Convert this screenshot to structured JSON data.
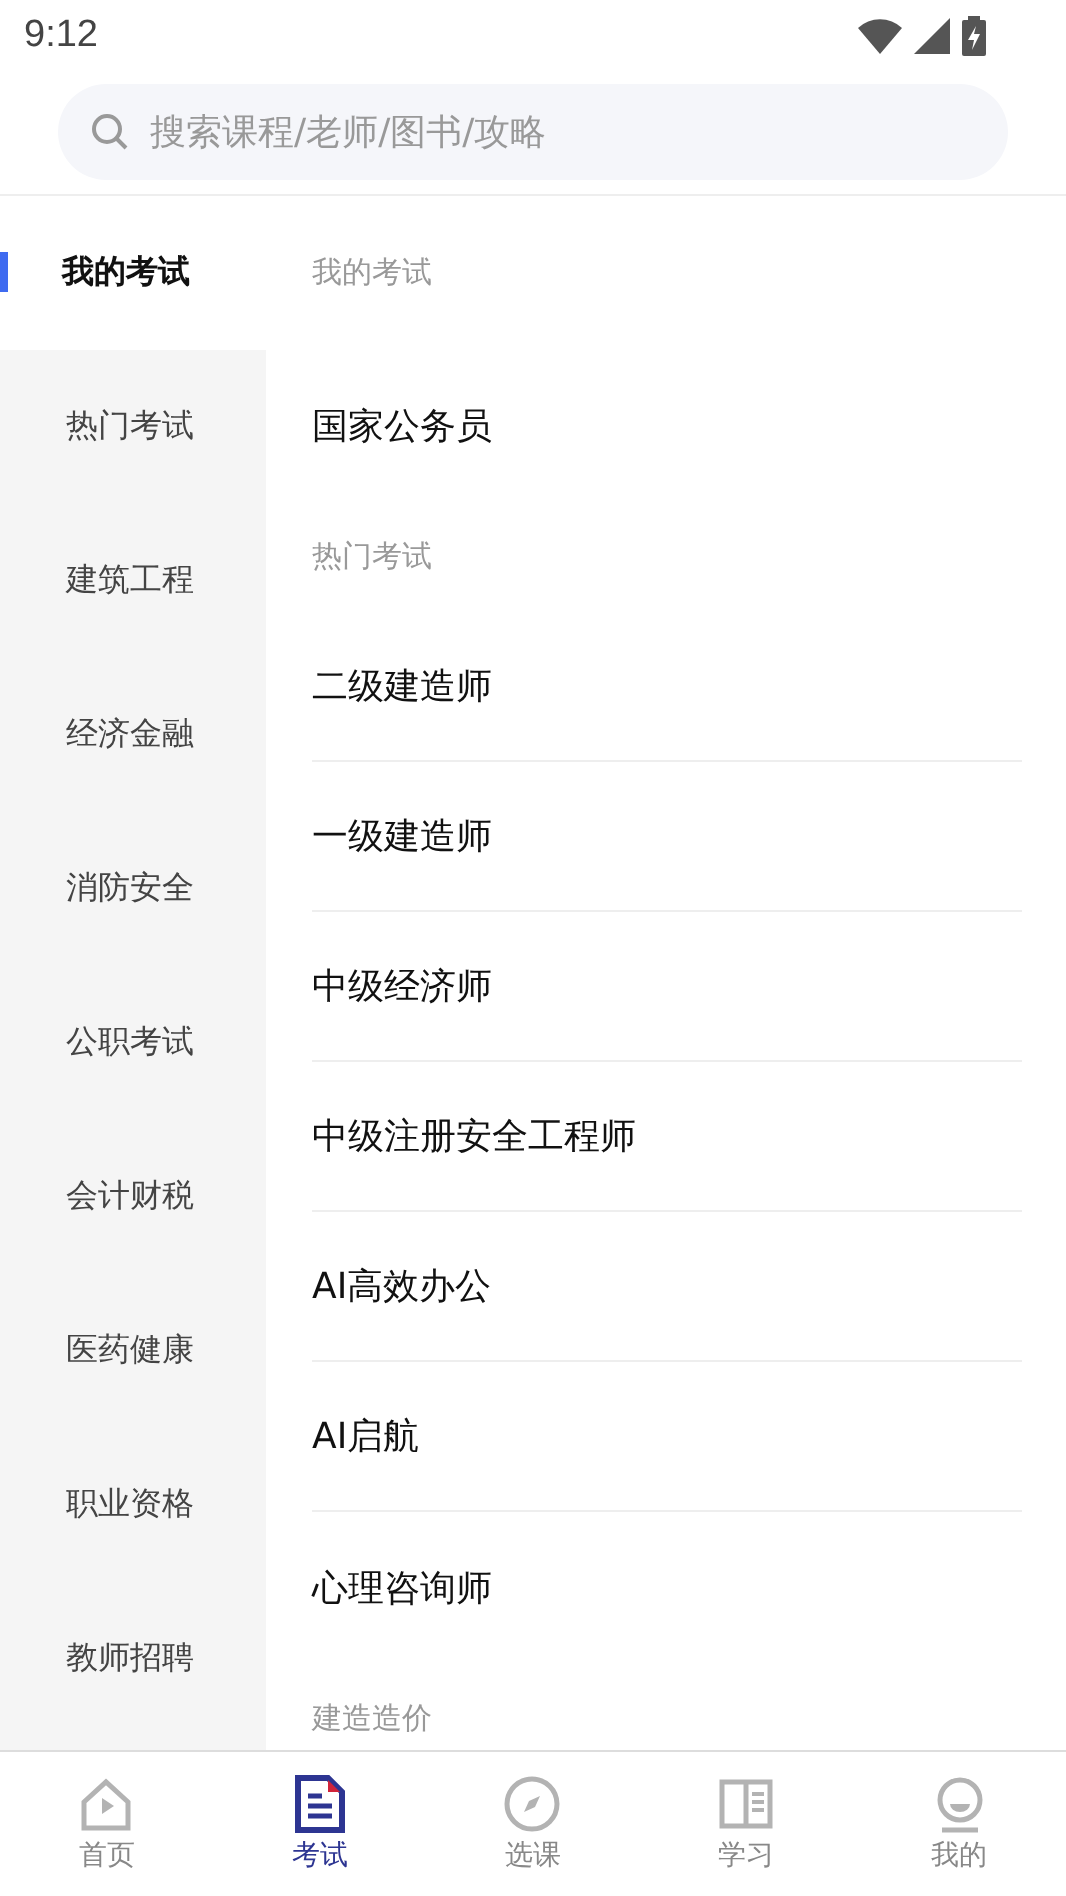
{
  "status_bar": {
    "time": "9:12"
  },
  "search": {
    "placeholder": "搜索课程/老师/图书/攻略"
  },
  "sidebar": {
    "items": [
      {
        "label": "我的考试",
        "selected": true
      },
      {
        "label": "热门考试",
        "selected": false
      },
      {
        "label": "建筑工程",
        "selected": false
      },
      {
        "label": "经济金融",
        "selected": false
      },
      {
        "label": "消防安全",
        "selected": false
      },
      {
        "label": "公职考试",
        "selected": false
      },
      {
        "label": "会计财税",
        "selected": false
      },
      {
        "label": "医药健康",
        "selected": false
      },
      {
        "label": "职业资格",
        "selected": false
      },
      {
        "label": "教师招聘",
        "selected": false
      }
    ]
  },
  "sections": [
    {
      "title": "我的考试",
      "items": [
        "国家公务员"
      ]
    },
    {
      "title": "热门考试",
      "items": [
        "二级建造师",
        "一级建造师",
        "中级经济师",
        "中级注册安全工程师",
        "AI高效办公",
        "AI启航",
        "心理咨询师"
      ]
    },
    {
      "title": "建造造价"
    }
  ],
  "bottom_nav": [
    {
      "label": "首页",
      "selected": false
    },
    {
      "label": "考试",
      "selected": true
    },
    {
      "label": "选课",
      "selected": false
    },
    {
      "label": "学习",
      "selected": false
    },
    {
      "label": "我的",
      "selected": false
    }
  ]
}
